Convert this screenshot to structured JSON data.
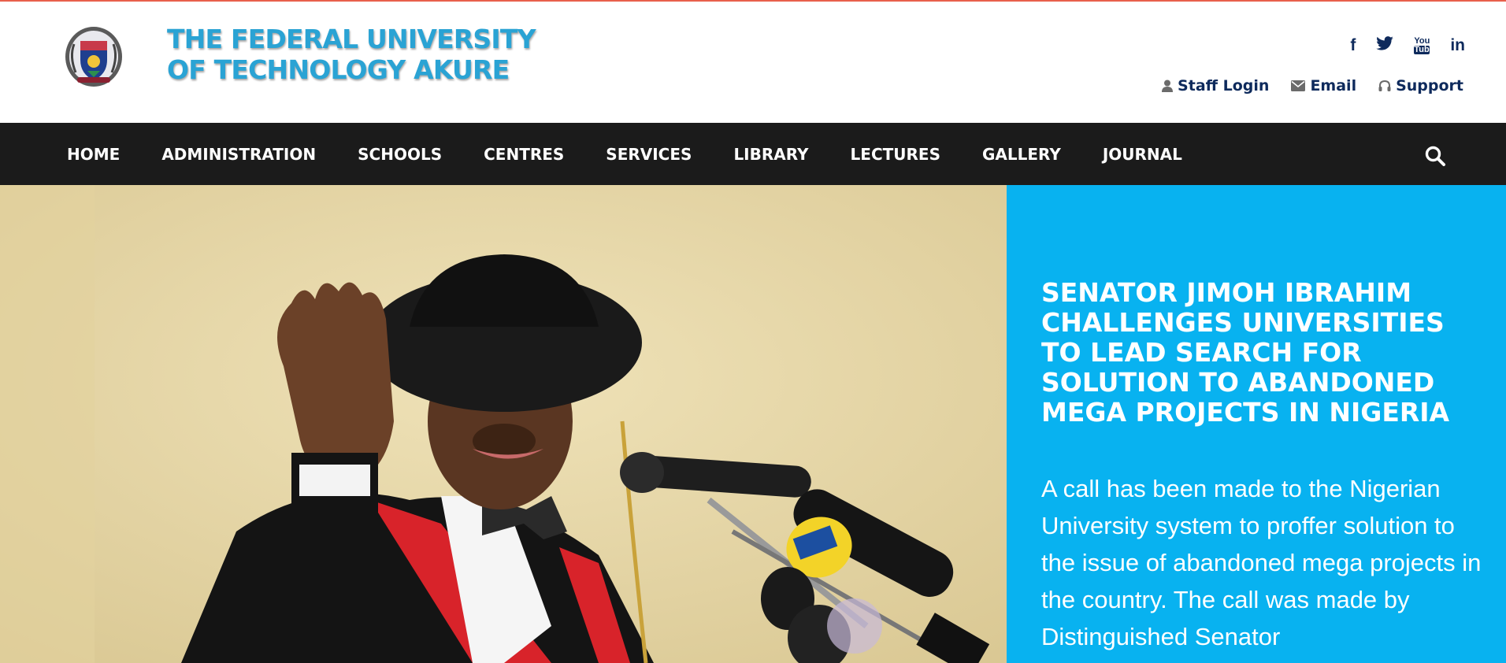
{
  "brand": {
    "title_line1": "THE FEDERAL UNIVERSITY",
    "title_line2": "OF TECHNOLOGY AKURE",
    "accent_color": "#2aa3d4"
  },
  "social": {
    "facebook": "f",
    "twitter": "twitter-icon",
    "youtube_line1": "You",
    "youtube_line2": "Tube",
    "linkedin": "in"
  },
  "top_links": {
    "staff_login": "Staff Login",
    "email": "Email",
    "support": "Support"
  },
  "nav": {
    "home": "HOME",
    "administration": "ADMINISTRATION",
    "schools": "SCHOOLS",
    "centres": "CENTRES",
    "services": "SERVICES",
    "library": "LIBRARY",
    "lectures": "LECTURES",
    "gallery": "GALLERY",
    "journal": "JOURNAL"
  },
  "feature": {
    "headline": "SENATOR JIMOH IBRAHIM CHALLENGES UNIVERSITIES TO LEAD SEARCH FOR SOLUTION TO ABANDONED MEGA PROJECTS IN NIGERIA",
    "body": "A call has been made to the Nigerian University system to proffer solution to the issue of abandoned mega projects in the country. The call was made by Distinguished Senator",
    "panel_color": "#08b2f0"
  },
  "colors": {
    "navbar": "#1b1b1b",
    "link_text": "#0e2a5c",
    "top_accent": "#e8604c"
  }
}
